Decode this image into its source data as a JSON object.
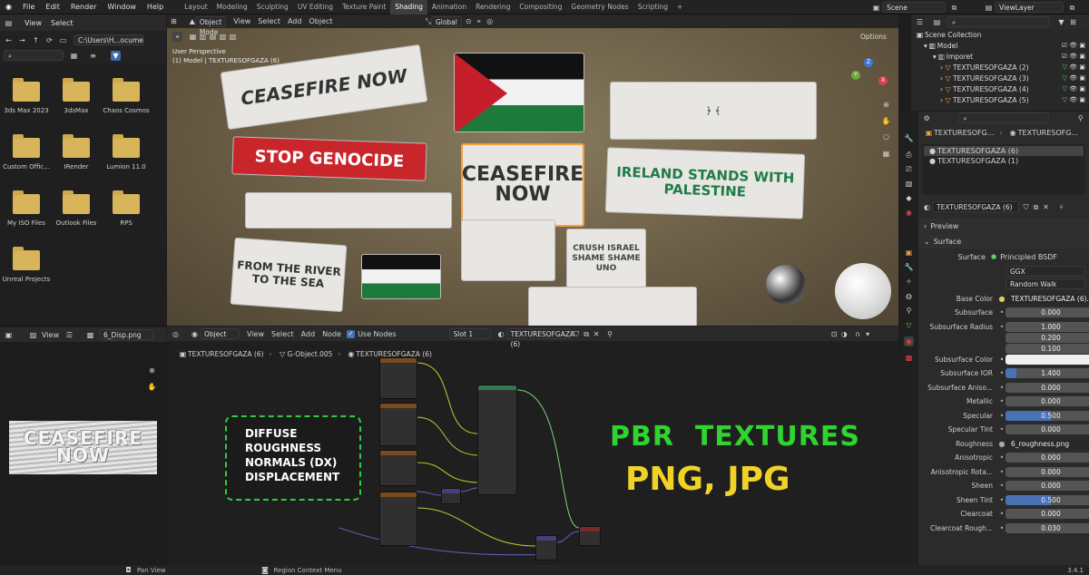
{
  "menu": [
    "File",
    "Edit",
    "Render",
    "Window",
    "Help"
  ],
  "workspaces": [
    "Layout",
    "Modeling",
    "Sculpting",
    "UV Editing",
    "Texture Paint",
    "Shading",
    "Animation",
    "Rendering",
    "Compositing",
    "Geometry Nodes",
    "Scripting"
  ],
  "active_workspace": "Shading",
  "add_tab": "+",
  "scene": "Scene",
  "view_layer": "ViewLayer",
  "filebrowser": {
    "view": "View",
    "select": "Select",
    "path": "C:\\Users\\H...ocuments\\",
    "items": [
      "3ds Max 2023",
      "3dsMax",
      "Chaos Cosmos",
      "Custom Offic...",
      "IRender",
      "Lumion 11.0",
      "My ISO Files",
      "Outlook Files",
      "RPS",
      "Unreal Projects"
    ]
  },
  "viewport": {
    "mode": "Object Mode",
    "view": "View",
    "select": "Select",
    "add": "Add",
    "object": "Object",
    "orientation": "Global",
    "options": "Options",
    "persp": "User Perspective",
    "info": "(1) Model | TEXTURESOFGAZA (6)",
    "banners": [
      "CEASEFIRE NOW",
      "STOP GENOCIDE",
      "CEASEFIRE NOW",
      "IRELAND STANDS WITH PALESTINE",
      "FROM THE RIVER TO THE SEA",
      "CRUSH ISRAEL SHAME SHAME UNO"
    ]
  },
  "imageeditor": {
    "view": "View",
    "image": "6_Disp.png",
    "preview": "CEASEFIRE NOW"
  },
  "nodeeditor": {
    "type": "Object",
    "view": "View",
    "select": "Select",
    "add": "Add",
    "node": "Node",
    "use_nodes": "Use Nodes",
    "slot": "Slot 1",
    "material": "TEXTURESOFGAZA (6)",
    "breadcrumb": [
      "TEXTURESOFGAZA (6)",
      "G-Object.005",
      "TEXTURESOFGAZA (6)"
    ],
    "overlay_list": [
      "DIFFUSE",
      "ROUGHNESS",
      "NORMALS (DX)",
      "DISPLACEMENT"
    ],
    "overlay_title": "PBR  TEXTURES",
    "overlay_formats": "PNG, JPG"
  },
  "outliner": {
    "root": "Scene Collection",
    "items": [
      {
        "name": "Model",
        "level": 1
      },
      {
        "name": "Imporet",
        "level": 2
      },
      {
        "name": "TEXTURESOFGAZA (2)",
        "level": 3
      },
      {
        "name": "TEXTURESOFGAZA (3)",
        "level": 3
      },
      {
        "name": "TEXTURESOFGAZA (4)",
        "level": 3
      },
      {
        "name": "TEXTURESOFGAZA (5)",
        "level": 3
      }
    ]
  },
  "properties": {
    "object": "TEXTURESOFG...",
    "material_tab": "TEXTURESOFG...",
    "slots": [
      "TEXTURESOFGAZA (6)",
      "TEXTURESOFGAZA (1)"
    ],
    "material": "TEXTURESOFGAZA (6)",
    "preview": "Preview",
    "surface_panel": "Surface",
    "surface_label": "Surface",
    "surface": "Principled BSDF",
    "distribution": "GGX",
    "subsurface_method": "Random Walk",
    "rows": [
      {
        "label": "Base Color",
        "value": "TEXTURESOFGAZA (6)..."
      },
      {
        "label": "Subsurface",
        "value": "0.000"
      },
      {
        "label": "Subsurface Radius",
        "value": "1.000"
      },
      {
        "label": "",
        "value": "0.200"
      },
      {
        "label": "",
        "value": "0.100"
      },
      {
        "label": "Subsurface Color",
        "value": ""
      },
      {
        "label": "Subsurface IOR",
        "value": "1.400",
        "fill": 0.12
      },
      {
        "label": "Subsurface Aniso...",
        "value": "0.000"
      },
      {
        "label": "Metallic",
        "value": "0.000"
      },
      {
        "label": "Specular",
        "value": "0.500",
        "fill": 0.5
      },
      {
        "label": "Specular Tint",
        "value": "0.000"
      },
      {
        "label": "Roughness",
        "value": "6_roughness.png"
      },
      {
        "label": "Anisotropic",
        "value": "0.000"
      },
      {
        "label": "Anisotropic Rota...",
        "value": "0.000"
      },
      {
        "label": "Sheen",
        "value": "0.000"
      },
      {
        "label": "Sheen Tint",
        "value": "0.500",
        "fill": 0.5
      },
      {
        "label": "Clearcoat",
        "value": "0.000"
      },
      {
        "label": "Clearcoat Rough...",
        "value": "0.030"
      }
    ]
  },
  "status": {
    "pan": "Pan View",
    "context": "Region Context Menu",
    "version": "3.4.1"
  }
}
